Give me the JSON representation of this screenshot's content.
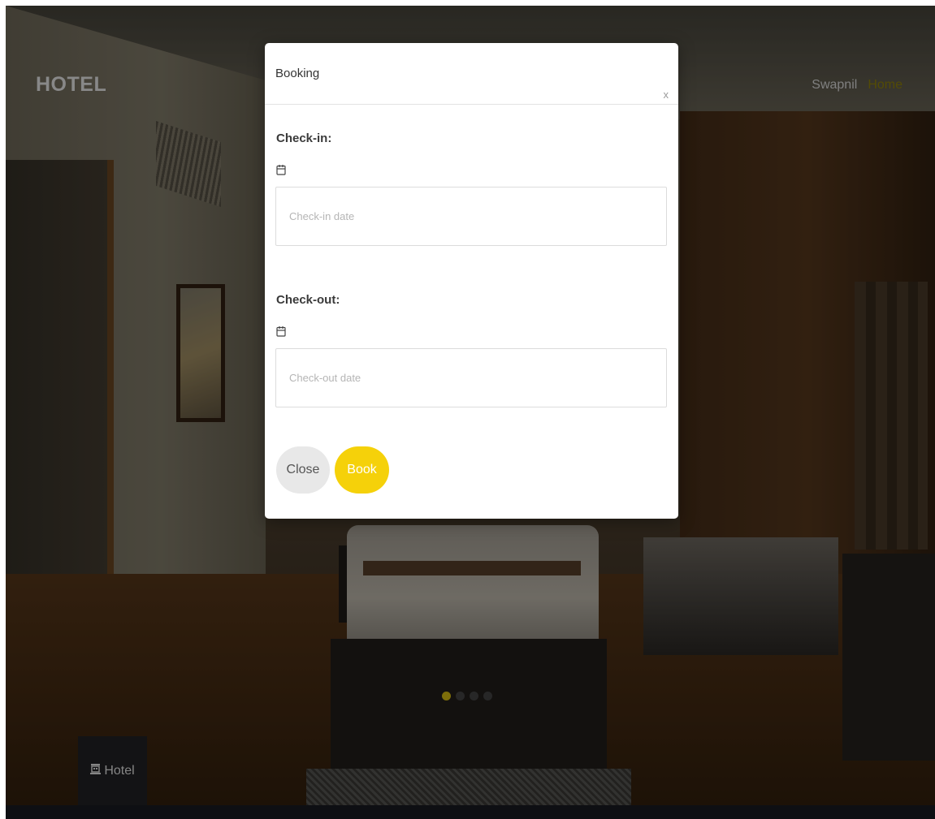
{
  "navbar": {
    "brand": "HOTEL",
    "user_link": "Swapnil",
    "home_link": "Home"
  },
  "modal": {
    "title": "Booking",
    "close_x": "x",
    "checkin": {
      "label": "Check-in:",
      "placeholder": "Check-in date",
      "icon": "calendar-icon"
    },
    "checkout": {
      "label": "Check-out:",
      "placeholder": "Check-out date",
      "icon": "calendar-icon"
    },
    "buttons": {
      "close": "Close",
      "book": "Book"
    }
  },
  "carousel": {
    "slide_count": 4,
    "active_index": 0
  },
  "bottom_tab": {
    "icon": "building-icon",
    "label": "Hotel"
  },
  "colors": {
    "accent": "#f5d10a",
    "nav_home": "#7b6f08",
    "close_button_bg": "#e8e8e8",
    "footer": "#15171c"
  }
}
